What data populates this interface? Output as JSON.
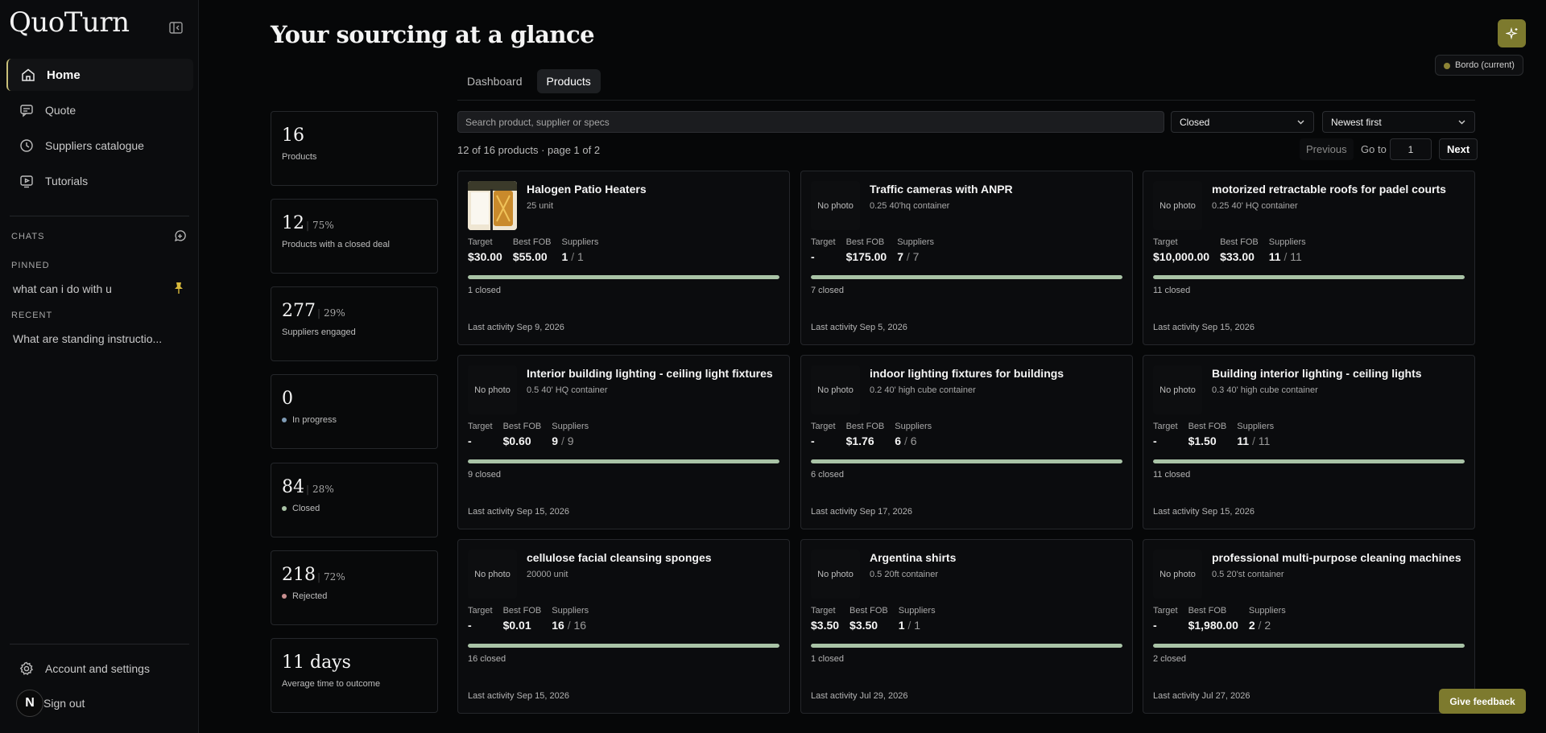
{
  "app": {
    "name": "QuoTurn"
  },
  "sidebar": {
    "nav": [
      {
        "label": "Home",
        "icon": "home-icon"
      },
      {
        "label": "Quote",
        "icon": "chat-icon"
      },
      {
        "label": "Suppliers catalogue",
        "icon": "clock-icon"
      },
      {
        "label": "Tutorials",
        "icon": "video-icon"
      }
    ],
    "chats_label": "CHATS",
    "pinned_label": "PINNED",
    "pinned": [
      "what can i do with u"
    ],
    "recent_label": "RECENT",
    "recent": [
      "What are standing instructio..."
    ],
    "account_settings": "Account and settings",
    "sign_out": "Sign out",
    "avatar_letter": "N"
  },
  "header": {
    "title": "Your sourcing at a glance",
    "account": "Bordo (current)",
    "accent_color": "#7d7a2e"
  },
  "tabs": [
    "Dashboard",
    "Products"
  ],
  "active_tab": "Products",
  "stats": [
    {
      "value": "16",
      "pct": "",
      "label": "Products",
      "dot": ""
    },
    {
      "value": "12",
      "pct": "75%",
      "label": "Products with a closed deal",
      "dot": ""
    },
    {
      "value": "277",
      "pct": "29%",
      "label": "Suppliers engaged",
      "dot": ""
    },
    {
      "value": "0",
      "pct": "",
      "label": "In progress",
      "dot": "#7f9bb5"
    },
    {
      "value": "84",
      "pct": "28%",
      "label": "Closed",
      "dot": "#a9c3a6"
    },
    {
      "value": "218",
      "pct": "72%",
      "label": "Rejected",
      "dot": "#c98f8f"
    },
    {
      "value": "11 days",
      "pct": "",
      "label": "Average time to outcome",
      "dot": ""
    }
  ],
  "filters": {
    "search_placeholder": "Search product, supplier or specs",
    "status": "Closed",
    "sort": "Newest first"
  },
  "pagination": {
    "summary": "12 of 16 products · page 1 of 2",
    "previous": "Previous",
    "goto_label": "Go to",
    "goto_value": "1",
    "next": "Next"
  },
  "labels": {
    "target": "Target",
    "best_fob": "Best FOB",
    "suppliers": "Suppliers",
    "no_photo": "No photo"
  },
  "products": [
    {
      "name": "Halogen Patio Heaters",
      "qty": "25 unit",
      "photo": true,
      "target": "$30.00",
      "best_fob": "$55.00",
      "sup": "1",
      "sup_total": "1",
      "closed": "1 closed",
      "progress": 1.0,
      "activity": "Last activity Sep 9, 2026"
    },
    {
      "name": "Traffic cameras with ANPR",
      "qty": "0.25 40'hq container",
      "photo": false,
      "target": "-",
      "best_fob": "$175.00",
      "sup": "7",
      "sup_total": "7",
      "closed": "7 closed",
      "progress": 1.0,
      "activity": "Last activity Sep 5, 2026"
    },
    {
      "name": "motorized retractable roofs for padel courts",
      "qty": "0.25 40' HQ container",
      "photo": false,
      "target": "$10,000.00",
      "best_fob": "$33.00",
      "sup": "11",
      "sup_total": "11",
      "closed": "11 closed",
      "progress": 1.0,
      "activity": "Last activity Sep 15, 2026"
    },
    {
      "name": "Interior building lighting - ceiling light fixtures",
      "qty": "0.5 40' HQ container",
      "photo": false,
      "target": "-",
      "best_fob": "$0.60",
      "sup": "9",
      "sup_total": "9",
      "closed": "9 closed",
      "progress": 1.0,
      "activity": "Last activity Sep 15, 2026"
    },
    {
      "name": "indoor lighting fixtures for buildings",
      "qty": "0.2 40' high cube container",
      "photo": false,
      "target": "-",
      "best_fob": "$1.76",
      "sup": "6",
      "sup_total": "6",
      "closed": "6 closed",
      "progress": 1.0,
      "activity": "Last activity Sep 17, 2026"
    },
    {
      "name": "Building interior lighting - ceiling lights",
      "qty": "0.3 40' high cube container",
      "photo": false,
      "target": "-",
      "best_fob": "$1.50",
      "sup": "11",
      "sup_total": "11",
      "closed": "11 closed",
      "progress": 1.0,
      "activity": "Last activity Sep 15, 2026"
    },
    {
      "name": "cellulose facial cleansing sponges",
      "qty": "20000 unit",
      "photo": false,
      "target": "-",
      "best_fob": "$0.01",
      "sup": "16",
      "sup_total": "16",
      "closed": "16 closed",
      "progress": 1.0,
      "activity": "Last activity Sep 15, 2026"
    },
    {
      "name": "Argentina shirts",
      "qty": "0.5 20ft container",
      "photo": false,
      "target": "$3.50",
      "best_fob": "$3.50",
      "sup": "1",
      "sup_total": "1",
      "closed": "1 closed",
      "progress": 1.0,
      "activity": "Last activity Jul 29, 2026"
    },
    {
      "name": "professional multi-purpose cleaning machines",
      "qty": "0.5 20'st container",
      "photo": false,
      "target": "-",
      "best_fob": "$1,980.00",
      "sup": "2",
      "sup_total": "2",
      "closed": "2 closed",
      "progress": 1.0,
      "activity": "Last activity Jul 27, 2026"
    }
  ],
  "feedback": "Give feedback"
}
